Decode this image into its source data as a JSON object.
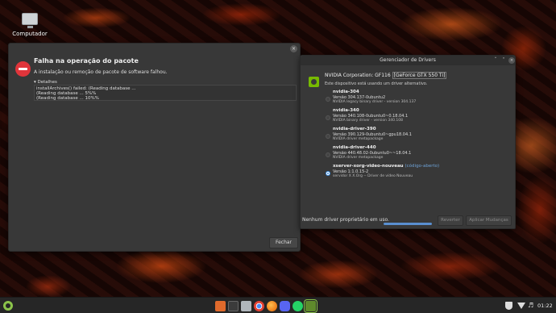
{
  "desktop": {
    "icon_label": "Computador"
  },
  "error_dialog": {
    "title": "Falha na operação do pacote",
    "subtitle": "A instalação ou remoção de pacote de software falhou.",
    "details_toggle": "▾ Detalhes",
    "details_lines": [
      "installArchives() failed: (Reading database ...",
      "(Reading database ... 5%%",
      "(Reading database ... 10%%"
    ],
    "close_button": "Fechar",
    "close_glyph": "×"
  },
  "drivers_window": {
    "title": "Gerenciador de Drivers",
    "controls": {
      "minimize": "ˇ",
      "maximize": "˄",
      "close": "×"
    },
    "gpu_vendor": "NVIDIA Corporation: GF116",
    "gpu_model": "[GeForce GTX 550 Ti]",
    "gpu_status": "Este dispositivo está usando um driver alternativo.",
    "drivers": [
      {
        "name": "nvidia-304",
        "tag": "",
        "version": "Versão 304.137-0ubuntu2",
        "description": "NVIDIA legacy binary driver - version 304.137",
        "selected": false
      },
      {
        "name": "nvidia-340",
        "tag": "",
        "version": "Versão 340.108-0ubuntu0~0.18.04.1",
        "description": "NVIDIA binary driver - version 340.108",
        "selected": false
      },
      {
        "name": "nvidia-driver-390",
        "tag": "",
        "version": "Versão 390.129-0ubuntu0~gpu18.04.1",
        "description": "NVIDIA driver metapackage",
        "selected": false
      },
      {
        "name": "nvidia-driver-440",
        "tag": "",
        "version": "Versão 440.48.02-0ubuntu0~~18.04.1",
        "description": "NVIDIA driver metapackage",
        "selected": false
      },
      {
        "name": "xserver-xorg-video-nouveau",
        "tag": "(código-aberto)",
        "version": "Versão 1:1.0.15-2",
        "description": "servidor X X.Org -- Driver de vídeo Nouveau",
        "selected": true
      }
    ],
    "footer_status": "Nenhum driver proprietário em uso.",
    "progress": 1.0,
    "revert_button": "Reverter",
    "apply_button": "Aplicar Mudanças"
  },
  "taskbar": {
    "apps": [
      "ubuntu-software-icon",
      "terminal-icon",
      "files-icon",
      "chrome-icon",
      "firefox-icon",
      "discord-icon",
      "whatsapp-icon",
      "driver-manager-icon"
    ],
    "clock": "01:22"
  }
}
